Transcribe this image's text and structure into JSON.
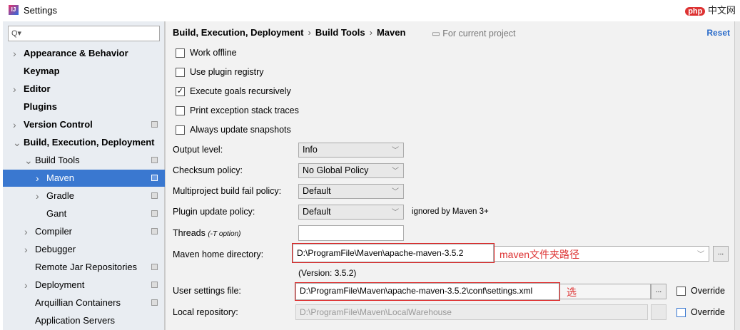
{
  "window": {
    "title": "Settings",
    "logo": "php中文网"
  },
  "sidebar": {
    "search_placeholder": "Q▾",
    "items": [
      {
        "label": "Appearance & Behavior",
        "bold": true,
        "arrow": true,
        "indent": 0
      },
      {
        "label": "Keymap",
        "bold": true,
        "arrow": false,
        "indent": 0
      },
      {
        "label": "Editor",
        "bold": true,
        "arrow": true,
        "indent": 0
      },
      {
        "label": "Plugins",
        "bold": true,
        "arrow": false,
        "indent": 0
      },
      {
        "label": "Version Control",
        "bold": true,
        "arrow": true,
        "indent": 0,
        "gear": true
      },
      {
        "label": "Build, Execution, Deployment",
        "bold": true,
        "arrow": true,
        "expanded": true,
        "indent": 0
      },
      {
        "label": "Build Tools",
        "arrow": true,
        "expanded": true,
        "indent": 1,
        "gear": true
      },
      {
        "label": "Maven",
        "arrow": true,
        "indent": 2,
        "gear": true,
        "selected": true
      },
      {
        "label": "Gradle",
        "arrow": true,
        "indent": 2,
        "gear": true
      },
      {
        "label": "Gant",
        "arrow": false,
        "indent": 2,
        "gear": true
      },
      {
        "label": "Compiler",
        "arrow": true,
        "indent": 1,
        "gear": true
      },
      {
        "label": "Debugger",
        "arrow": true,
        "indent": 1
      },
      {
        "label": "Remote Jar Repositories",
        "arrow": false,
        "indent": 1,
        "gear": true
      },
      {
        "label": "Deployment",
        "arrow": true,
        "indent": 1,
        "gear": true
      },
      {
        "label": "Arquillian Containers",
        "arrow": false,
        "indent": 1,
        "gear": true
      },
      {
        "label": "Application Servers",
        "arrow": false,
        "indent": 1
      }
    ]
  },
  "main": {
    "breadcrumb": [
      "Build, Execution, Deployment",
      "Build Tools",
      "Maven"
    ],
    "scope": "For current project",
    "reset": "Reset",
    "checkboxes": [
      {
        "label": "Work offline",
        "checked": false
      },
      {
        "label": "Use plugin registry",
        "checked": false
      },
      {
        "label": "Execute goals recursively",
        "checked": true
      },
      {
        "label": "Print exception stack traces",
        "checked": false
      },
      {
        "label": "Always update snapshots",
        "checked": false
      }
    ],
    "output_level": {
      "label": "Output level:",
      "value": "Info"
    },
    "checksum": {
      "label": "Checksum policy:",
      "value": "No Global Policy"
    },
    "fail_policy": {
      "label": "Multiproject build fail policy:",
      "value": "Default"
    },
    "plugin_update": {
      "label": "Plugin update policy:",
      "value": "Default",
      "note": "ignored by Maven 3+"
    },
    "threads": {
      "label": "Threads",
      "hint": "(-T option)",
      "value": ""
    },
    "maven_home": {
      "label": "Maven home directory:",
      "value": "D:\\ProgramFile\\Maven\\apache-maven-3.5.2",
      "note": "maven文件夹路径",
      "version": "(Version: 3.5.2)"
    },
    "user_settings": {
      "label": "User settings file:",
      "value": "D:\\ProgramFile\\Maven\\apache-maven-3.5.2\\conf\\settings.xml",
      "note": "选",
      "override": "Override"
    },
    "local_repo": {
      "label": "Local repository:",
      "value": "D:\\ProgramFile\\Maven\\LocalWarehouse",
      "override": "Override"
    },
    "browse": "..."
  }
}
